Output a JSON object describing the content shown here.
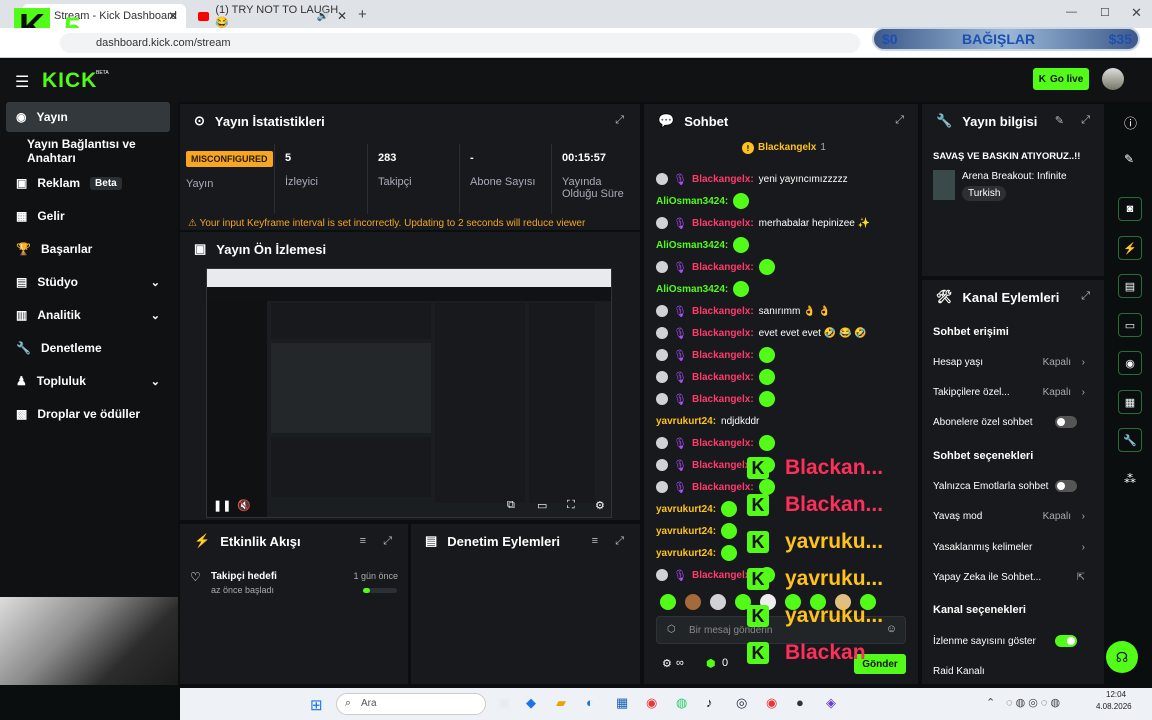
{
  "browser": {
    "tab1_title": "Stream - Kick Dashboard",
    "tab2_title": "(1) TRY NOT TO LAUGH 😂",
    "url": "dashboard.kick.com/stream",
    "overlay_logo_number": "5",
    "donation_left": "$0",
    "donation_label": "BAĞIŞLAR",
    "donation_right": "$35"
  },
  "header": {
    "logo": "KICK",
    "logo_badge": "BETA",
    "go_live": "Go live"
  },
  "sidebar": {
    "items": [
      {
        "label": "Yayın",
        "icon": "broadcast-icon"
      },
      {
        "label": "Yayın Bağlantısı ve Anahtarı",
        "icon": ""
      },
      {
        "label": "Reklam",
        "icon": "ad-icon",
        "badge": "Beta"
      },
      {
        "label": "Gelir",
        "icon": "chart-icon"
      },
      {
        "label": "Başarılar",
        "icon": "trophy-icon"
      },
      {
        "label": "Stüdyo",
        "icon": "studio-icon"
      },
      {
        "label": "Analitik",
        "icon": "analytics-icon"
      },
      {
        "label": "Denetleme",
        "icon": "wrench-icon"
      },
      {
        "label": "Topluluk",
        "icon": "community-icon"
      },
      {
        "label": "Droplar ve ödüller",
        "icon": "gift-icon"
      }
    ]
  },
  "stats": {
    "title": "Yayın İstatistikleri",
    "status_badge": "MISCONFIGURED",
    "status_label": "Yayın",
    "viewers_value": "5",
    "viewers_label": "İzleyici",
    "followers_value": "283",
    "followers_label": "Takipçi",
    "subs_value": "-",
    "subs_label": "Abone Sayısı",
    "uptime_value": "00:15:57",
    "uptime_label": "Yayında Olduğu Süre",
    "warning": "Your input Keyframe interval is set incorrectly. Updating to 2 seconds will reduce viewer"
  },
  "preview": {
    "title": "Yayın Ön İzlemesi"
  },
  "activity": {
    "title": "Etkinlik Akışı",
    "event_title": "Takipçi hedefi",
    "event_sub": "az önce başladı",
    "event_time": "1 gün önce",
    "event_progress": 0.2
  },
  "moderation": {
    "title": "Denetim Eylemleri"
  },
  "chat": {
    "title": "Sohbet",
    "pinned_user": "Blackangelx",
    "pinned_count": "1",
    "messages": [
      {
        "user": "Blackangelx",
        "text": "yeni yayıncımızzzzz",
        "color": "pink",
        "dot": true
      },
      {
        "user": "AliOsman3424",
        "text": "",
        "color": "green",
        "dot": false
      },
      {
        "user": "Blackangelx",
        "text": "merhabalar hepinizee ✨",
        "color": "pink",
        "dot": true
      },
      {
        "user": "AliOsman3424",
        "text": "",
        "color": "green",
        "dot": false
      },
      {
        "user": "Blackangelx",
        "text": "",
        "color": "pink",
        "dot": true
      },
      {
        "user": "AliOsman3424",
        "text": "",
        "color": "green",
        "dot": false
      },
      {
        "user": "Blackangelx",
        "text": "sanırımm 👌 👌",
        "color": "pink",
        "dot": true
      },
      {
        "user": "Blackangelx",
        "text": "evet evet evet 🤣 😂 🤣",
        "color": "pink",
        "dot": true
      },
      {
        "user": "Blackangelx",
        "text": "",
        "color": "pink",
        "dot": true
      },
      {
        "user": "Blackangelx",
        "text": "",
        "color": "pink",
        "dot": true
      },
      {
        "user": "Blackangelx",
        "text": "",
        "color": "pink",
        "dot": true
      },
      {
        "user": "yavrukurt24",
        "text": "ndjdkddr",
        "color": "yellow",
        "dot": false
      },
      {
        "user": "Blackangelx",
        "text": "",
        "color": "pink",
        "dot": true
      },
      {
        "user": "Blackangelx",
        "text": "",
        "color": "pink",
        "dot": true
      },
      {
        "user": "Blackangelx",
        "text": "",
        "color": "pink",
        "dot": true
      },
      {
        "user": "yavrukurt24",
        "text": "",
        "color": "yellow",
        "dot": false
      },
      {
        "user": "yavrukurt24",
        "text": "",
        "color": "yellow",
        "dot": false
      },
      {
        "user": "yavrukurt24",
        "text": "",
        "color": "yellow",
        "dot": false
      },
      {
        "user": "Blackangelx",
        "text": "",
        "color": "pink",
        "dot": true
      }
    ],
    "input_placeholder": "Bir mesaj gönderin",
    "points": "0",
    "send_label": "Gönder"
  },
  "overlay_alerts": [
    {
      "text": "Blackan...",
      "color": "pink"
    },
    {
      "text": "Blackan...",
      "color": "pink"
    },
    {
      "text": "yavruku...",
      "color": "yellow"
    },
    {
      "text": "yavruku...",
      "color": "yellow"
    },
    {
      "text": "yavruku...",
      "color": "yellow"
    },
    {
      "text": "Blackan",
      "color": "pink"
    }
  ],
  "stream_info": {
    "title": "Yayın bilgisi",
    "stream_title": "SAVAŞ VE BASKIN ATIYORUZ..!!",
    "game": "Arena Breakout: Infinite",
    "language": "Turkish"
  },
  "channel_actions": {
    "title": "Kanal Eylemleri",
    "chat_access_heading": "Sohbet erişimi",
    "account_age": "Hesap yaşı",
    "account_age_value": "Kapalı",
    "followers_only": "Takipçilere özel...",
    "followers_only_value": "Kapalı",
    "subs_only": "Abonelere özel sohbet",
    "chat_options_heading": "Sohbet seçenekleri",
    "emote_only": "Yalnızca Emotlarla sohbet",
    "slow_mode": "Yavaş mod",
    "slow_mode_value": "Kapalı",
    "banned_words": "Yasaklanmış kelimeler",
    "ai_chat": "Yapay Zeka ile Sohbet...",
    "channel_options_heading": "Kanal seçenekleri",
    "show_viewers": "İzlenme sayısını göster",
    "raid": "Raid Kanalı"
  },
  "taskbar": {
    "search_placeholder": "Ara",
    "time": "12:04",
    "date": "4.08.2026"
  },
  "colors": {
    "kick_green": "#53fc18",
    "pink_user": "#ff3b6b",
    "yellow_user": "#ffc21a",
    "misconfigured": "#f6a623"
  }
}
